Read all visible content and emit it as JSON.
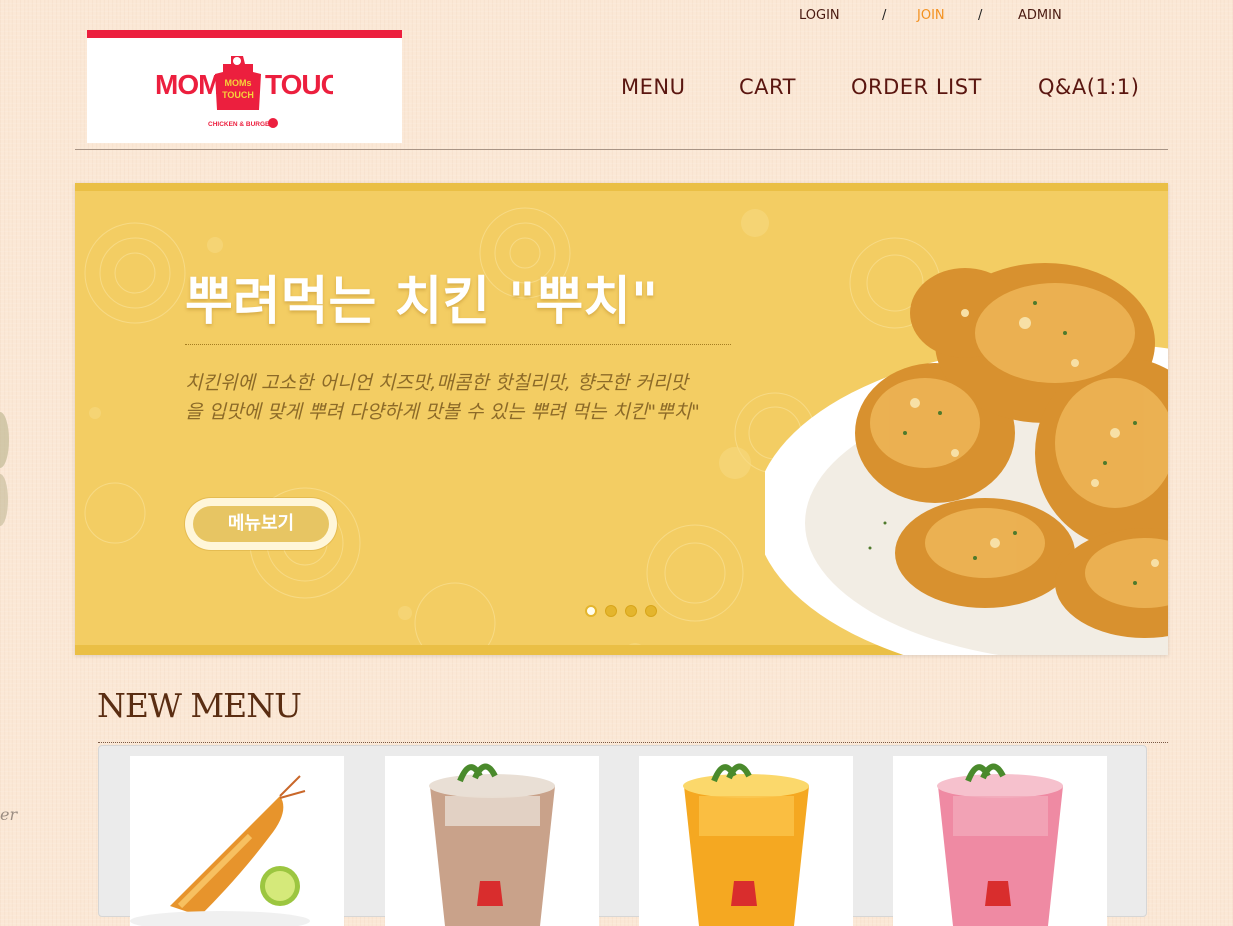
{
  "top_links": {
    "login": "LOGIN",
    "sep1": "/",
    "join": "JOIN",
    "sep2": "/",
    "admin": "ADMIN"
  },
  "brand": {
    "name_left": "MOM's",
    "name_right": "TOUCH",
    "badge_top": "MOMs",
    "badge_bottom": "TOUCH",
    "tagline": "CHICKEN & BURGER",
    "accent_color": "#ec1f3e"
  },
  "nav": {
    "menu": "MENU",
    "cart": "CART",
    "order_list": "ORDER LIST",
    "qna": "Q&A(1:1)"
  },
  "banner": {
    "title": "뿌려먹는 치킨 \"뿌치\"",
    "description": "치킨위에 고소한 어니언 치즈맛,매콤한 핫칠리맛, 향긋한 커리맛을 입맛에 맞게 뿌려 다양하게 맛볼 수 있는 뿌려 먹는 치킨\"뿌치\"",
    "button_label": "메뉴보기",
    "slide_count": 4,
    "active_slide": 1
  },
  "new_menu": {
    "title": "NEW MENU",
    "items": [
      {
        "name": "shrimp"
      },
      {
        "name": "milk-tea-drink"
      },
      {
        "name": "mango-drink"
      },
      {
        "name": "strawberry-drink"
      }
    ]
  },
  "side_text": "er"
}
